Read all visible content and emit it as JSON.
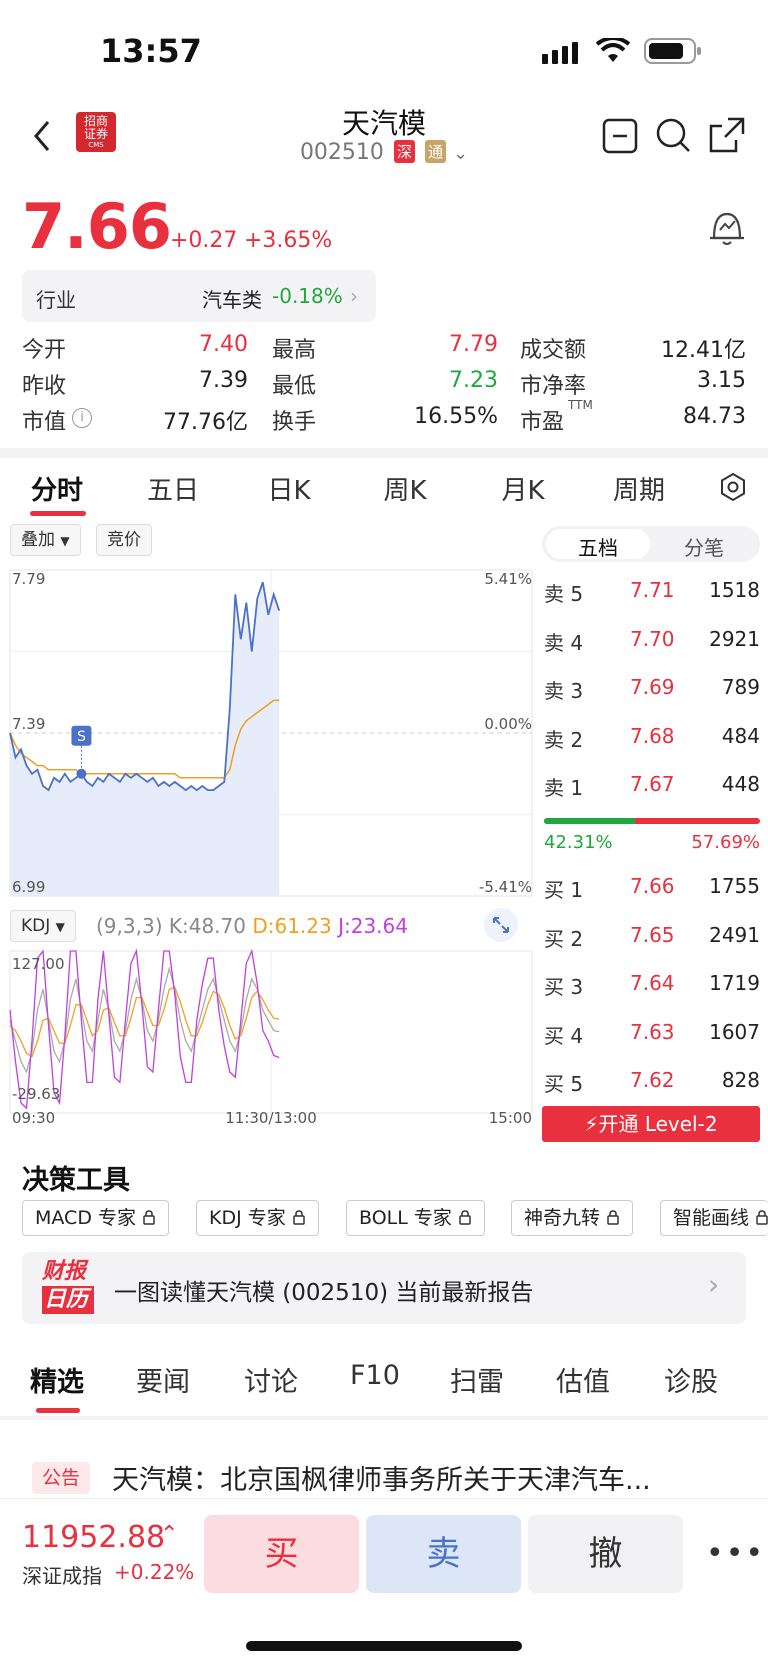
{
  "status_bar": {
    "time": "13:57"
  },
  "header": {
    "broker_logo_text": "招商证券",
    "broker_logo_sub": "CMS",
    "title": "天汽模",
    "code": "002510",
    "market_badge": "深",
    "connect_badge": "通"
  },
  "quote": {
    "price": "7.66",
    "change": "+0.27",
    "change_pct": "+3.65%",
    "industry_label": "行业",
    "industry_name": "汽车类",
    "industry_change": "-0.18%"
  },
  "stats": [
    {
      "label": "今开",
      "value": "7.40"
    },
    {
      "label": "最高",
      "value": "7.79"
    },
    {
      "label": "成交额",
      "value": "12.41亿"
    },
    {
      "label": "昨收",
      "value": "7.39"
    },
    {
      "label": "最低",
      "value": "7.23"
    },
    {
      "label": "市净率",
      "value": "3.15"
    },
    {
      "label": "市值",
      "value": "77.76亿"
    },
    {
      "label": "换手",
      "value": "16.55%"
    },
    {
      "label": "市盈",
      "sup": "TTM",
      "value": "84.73"
    }
  ],
  "chart_tabs": [
    "分时",
    "五日",
    "日K",
    "周K",
    "月K",
    "周期"
  ],
  "chart_controls": {
    "overlay": "叠加",
    "auction": "竞价"
  },
  "orderbook_tabs": [
    "五档",
    "分笔"
  ],
  "chart_data": [
    {
      "type": "line",
      "title": "分时",
      "x_ticks": [
        "09:30",
        "11:30/13:00",
        "15:00"
      ],
      "y_left_ticks": [
        "7.79",
        "7.39",
        "6.99"
      ],
      "y_right_ticks": [
        "5.41%",
        "0.00%",
        "-5.41%"
      ],
      "ylim": [
        6.99,
        7.79
      ],
      "marker": "S",
      "series": [
        {
          "values": [
            7.39,
            7.33,
            7.35,
            7.31,
            7.29,
            7.3,
            7.26,
            7.25,
            7.28,
            7.27,
            7.29,
            7.27,
            7.28,
            7.29,
            7.27,
            7.26,
            7.28,
            7.27,
            7.29,
            7.28,
            7.27,
            7.29,
            7.28,
            7.29,
            7.28,
            7.27,
            7.28,
            7.26,
            7.27,
            7.26,
            7.27,
            7.26,
            7.25,
            7.26,
            7.25,
            7.26,
            7.25,
            7.25,
            7.26,
            7.27,
            7.45,
            7.73,
            7.62,
            7.71,
            7.59,
            7.72,
            7.76,
            7.68,
            7.73,
            7.69
          ]
        },
        {
          "values": [
            7.39,
            7.36,
            7.34,
            7.33,
            7.32,
            7.31,
            7.31,
            7.3,
            7.3,
            7.3,
            7.3,
            7.3,
            7.3,
            7.29,
            7.29,
            7.29,
            7.29,
            7.29,
            7.29,
            7.29,
            7.29,
            7.29,
            7.29,
            7.29,
            7.29,
            7.29,
            7.29,
            7.29,
            7.29,
            7.29,
            7.29,
            7.28,
            7.28,
            7.28,
            7.28,
            7.28,
            7.28,
            7.28,
            7.28,
            7.28,
            7.3,
            7.36,
            7.4,
            7.42,
            7.43,
            7.44,
            7.45,
            7.46,
            7.47,
            7.47
          ]
        }
      ]
    },
    {
      "type": "line",
      "title": "KDJ",
      "params": "(9,3,3)",
      "ylim": [
        -29.63,
        127.0
      ],
      "y_ticks": [
        "127.00",
        "-29.63"
      ],
      "series": [
        {
          "name": "K:48.70",
          "values": [
            60,
            40,
            20,
            10,
            30,
            70,
            90,
            60,
            30,
            20,
            40,
            80,
            100,
            70,
            40,
            30,
            60,
            90,
            70,
            40,
            30,
            50,
            80,
            100,
            80,
            50,
            40,
            60,
            90,
            110,
            90,
            60,
            40,
            30,
            50,
            70,
            90,
            100,
            80,
            60,
            40,
            30,
            50,
            80,
            100,
            90,
            70,
            60,
            50,
            49
          ]
        },
        {
          "name": "D:61.23",
          "values": [
            55,
            50,
            40,
            28,
            25,
            40,
            60,
            62,
            50,
            38,
            38,
            55,
            75,
            75,
            60,
            45,
            50,
            70,
            72,
            58,
            45,
            45,
            62,
            82,
            82,
            68,
            55,
            55,
            70,
            90,
            92,
            78,
            60,
            45,
            45,
            58,
            75,
            88,
            85,
            72,
            55,
            42,
            45,
            62,
            82,
            88,
            80,
            70,
            62,
            61
          ]
        },
        {
          "name": "J:23.64",
          "values": [
            70,
            20,
            -20,
            -25,
            40,
            120,
            127,
            55,
            -10,
            -20,
            45,
            127,
            127,
            60,
            0,
            0,
            80,
            127,
            65,
            5,
            0,
            60,
            115,
            127,
            75,
            15,
            10,
            70,
            127,
            127,
            85,
            25,
            0,
            0,
            60,
            95,
            120,
            120,
            70,
            35,
            10,
            5,
            60,
            115,
            127,
            95,
            50,
            40,
            26,
            24
          ]
        }
      ]
    }
  ],
  "kdj": {
    "indicator": "KDJ",
    "params": "(9,3,3)",
    "k": "K:48.70",
    "d": "D:61.23",
    "j": "J:23.64"
  },
  "orderbook": {
    "asks": [
      {
        "label": "卖 5",
        "price": "7.71",
        "vol": "1518"
      },
      {
        "label": "卖 4",
        "price": "7.70",
        "vol": "2921"
      },
      {
        "label": "卖 3",
        "price": "7.69",
        "vol": "789"
      },
      {
        "label": "卖 2",
        "price": "7.68",
        "vol": "484"
      },
      {
        "label": "卖 1",
        "price": "7.67",
        "vol": "448"
      }
    ],
    "buy_ratio": "42.31%",
    "sell_ratio": "57.69%",
    "buy_ratio_value": 0.4231,
    "bids": [
      {
        "label": "买 1",
        "price": "7.66",
        "vol": "1755"
      },
      {
        "label": "买 2",
        "price": "7.65",
        "vol": "2491"
      },
      {
        "label": "买 3",
        "price": "7.64",
        "vol": "1719"
      },
      {
        "label": "买 4",
        "price": "7.63",
        "vol": "1607"
      },
      {
        "label": "买 5",
        "price": "7.62",
        "vol": "828"
      }
    ],
    "level2_label": "开通 Level-2"
  },
  "tools": {
    "title": "决策工具",
    "items": [
      "MACD 专家",
      "KDJ 专家",
      "BOLL 专家",
      "神奇九转",
      "智能画线"
    ]
  },
  "report": {
    "logo_top": "财报",
    "logo_bottom": "日历",
    "text": "一图读懂天汽模 (002510) 当前最新报告"
  },
  "news_tabs": [
    "精选",
    "要闻",
    "讨论",
    "F10",
    "扫雷",
    "估值",
    "诊股"
  ],
  "news": [
    {
      "tag": "公告",
      "title": "天汽模：北京国枫律师事务所关于天津汽车..."
    }
  ],
  "index": {
    "value": "11952.88",
    "name": "深证成指",
    "change": "+0.22%"
  },
  "actions": {
    "buy": "买",
    "sell": "卖",
    "cancel": "撤"
  },
  "colors": {
    "up": "#e8303f",
    "down": "#1fa83e",
    "accent": "#e8303f",
    "price_line": "#4a72c8",
    "avg_line": "#f0a020"
  }
}
